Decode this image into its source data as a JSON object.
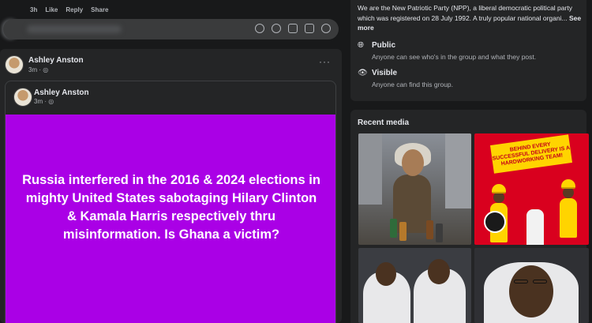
{
  "comment": {
    "time": "3h",
    "like_label": "Like",
    "reply_label": "Reply",
    "share_label": "Share",
    "icons": [
      "sticker-icon",
      "emoji-icon",
      "camera-icon",
      "gif-icon",
      "post-sticker-icon"
    ]
  },
  "post": {
    "author": "Ashley Anston",
    "meta": "3m · ",
    "more_label": "···",
    "shared": {
      "author": "Ashley Anston",
      "meta": "3m · ",
      "background": "#aa00e6",
      "text": "Russia interfered in the 2016 & 2024 elections in mighty United States sabotaging Hilary Clinton & Kamala Harris respectively thru misinformation. Is Ghana a victim?"
    }
  },
  "about": {
    "description": "We are the New Patriotic Party (NPP), a liberal democratic political party which was registered on 28 July 1992. A truly popular national organi...",
    "see_more": "See more",
    "public_title": "Public",
    "public_sub": "Anyone can see who's in the group and what they post.",
    "visible_title": "Visible",
    "visible_sub": "Anyone can find this group."
  },
  "media": {
    "title": "Recent media",
    "poster_text": "BEHIND EVERY SUCCESSFUL DELIVERY IS A HARDWORKING TEAM!"
  }
}
